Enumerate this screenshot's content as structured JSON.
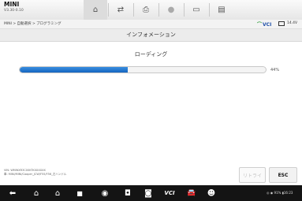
{
  "header": {
    "make": "MINI",
    "version": "V3.30-0.10",
    "tools": [
      {
        "icon": "home-icon",
        "glyph": "⌂",
        "active": true
      },
      {
        "icon": "vehicle-swap-icon",
        "glyph": "⇄",
        "active": false
      },
      {
        "icon": "printer-icon",
        "glyph": "⎙",
        "active": false
      },
      {
        "icon": "help-icon",
        "glyph": "●",
        "active": false
      },
      {
        "icon": "save-icon",
        "glyph": "▭",
        "active": false
      },
      {
        "icon": "data-logging-icon",
        "glyph": "▤",
        "active": false
      }
    ]
  },
  "breadcrumb": "MINI > 自動選択 > プログラミング",
  "status": {
    "vci_label": "VCI",
    "voltage": "14.4V"
  },
  "page_title": "インフォメーション",
  "loading": {
    "label": "ローディング",
    "progress": 44,
    "percent_text": "44%"
  },
  "footer": {
    "vin": "VIN: WMWXR3C00KTK0XXXXX",
    "path": "車: MINI/MINI/Cooper_JCW/F55/F56_左ハンドル"
  },
  "buttons": {
    "retry": "リトライ",
    "esc": "ESC"
  },
  "system_bar": {
    "icons": [
      {
        "name": "back-icon",
        "glyph": "⬅"
      },
      {
        "name": "android-home-icon",
        "glyph": "⌂"
      },
      {
        "name": "vehicle-home-icon",
        "glyph": "⌂"
      },
      {
        "name": "recent-apps-icon",
        "glyph": "■"
      },
      {
        "name": "browser-icon",
        "glyph": "◉"
      },
      {
        "name": "camera-icon",
        "glyph": "◘"
      },
      {
        "name": "display-icon",
        "glyph": "◙"
      },
      {
        "name": "vci-icon",
        "glyph": "VCI"
      },
      {
        "name": "car-icon",
        "glyph": "🚘"
      },
      {
        "name": "remote-support-icon",
        "glyph": "☻"
      }
    ],
    "status_text": "◎ ◉ 91% ▮16:23"
  },
  "colors": {
    "progress": "#1565c0",
    "system_bar": "#141414",
    "vci_green": "#2e9c3a",
    "vci_blue": "#1e4fa8"
  }
}
